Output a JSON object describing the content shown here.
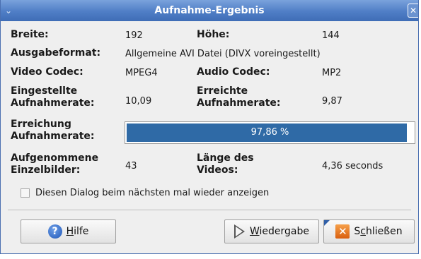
{
  "window": {
    "title": "Aufnahme-Ergebnis",
    "menu_icon": "chevron-down-icon",
    "close_icon": "close-icon",
    "close_glyph": "✕"
  },
  "fields": {
    "breite_label": "Breite:",
    "breite_value": "192",
    "hoehe_label": "Höhe:",
    "hoehe_value": "144",
    "ausgabeformat_label": "Ausgabeformat:",
    "ausgabeformat_value": "Allgemeine AVI Datei (DIVX voreingestellt)",
    "video_codec_label": "Video Codec:",
    "video_codec_value": "MPEG4",
    "audio_codec_label": "Audio Codec:",
    "audio_codec_value": "MP2",
    "eingestellte_label_1": "Eingestellte",
    "eingestellte_label_2": "Aufnahmerate:",
    "eingestellte_value": "10,09",
    "erreichte_label_1": "Erreichte",
    "erreichte_label_2": "Aufnahmerate:",
    "erreichte_value": "9,87",
    "erreichung_label_1": "Erreichung",
    "erreichung_label_2": "Aufnahmerate:",
    "aufgenommene_label_1": "Aufgenommene",
    "aufgenommene_label_2": "Einzelbilder:",
    "aufgenommene_value": "43",
    "laenge_label_1": "Länge des",
    "laenge_label_2": "Videos:",
    "laenge_value": "4,36 seconds"
  },
  "progress": {
    "text": "97,86 %",
    "fraction": 0.9786,
    "color": "#2f6aa6"
  },
  "checkbox": {
    "label": "Diesen Dialog beim nächsten mal wieder anzeigen",
    "checked": false
  },
  "buttons": {
    "help_mnemonic": "H",
    "help_rest": "ilfe",
    "help_icon": "help-icon",
    "play_mnemonic": "W",
    "play_rest": "iedergabe",
    "play_icon": "play-icon",
    "close_prefix": "S",
    "close_mnemonic": "c",
    "close_rest": "hließen",
    "close_icon": "close-x-icon"
  },
  "colors": {
    "titlebar": "#4f7ec6",
    "accent": "#2f6aa6",
    "close_icon_bg": "#e06a1a"
  }
}
